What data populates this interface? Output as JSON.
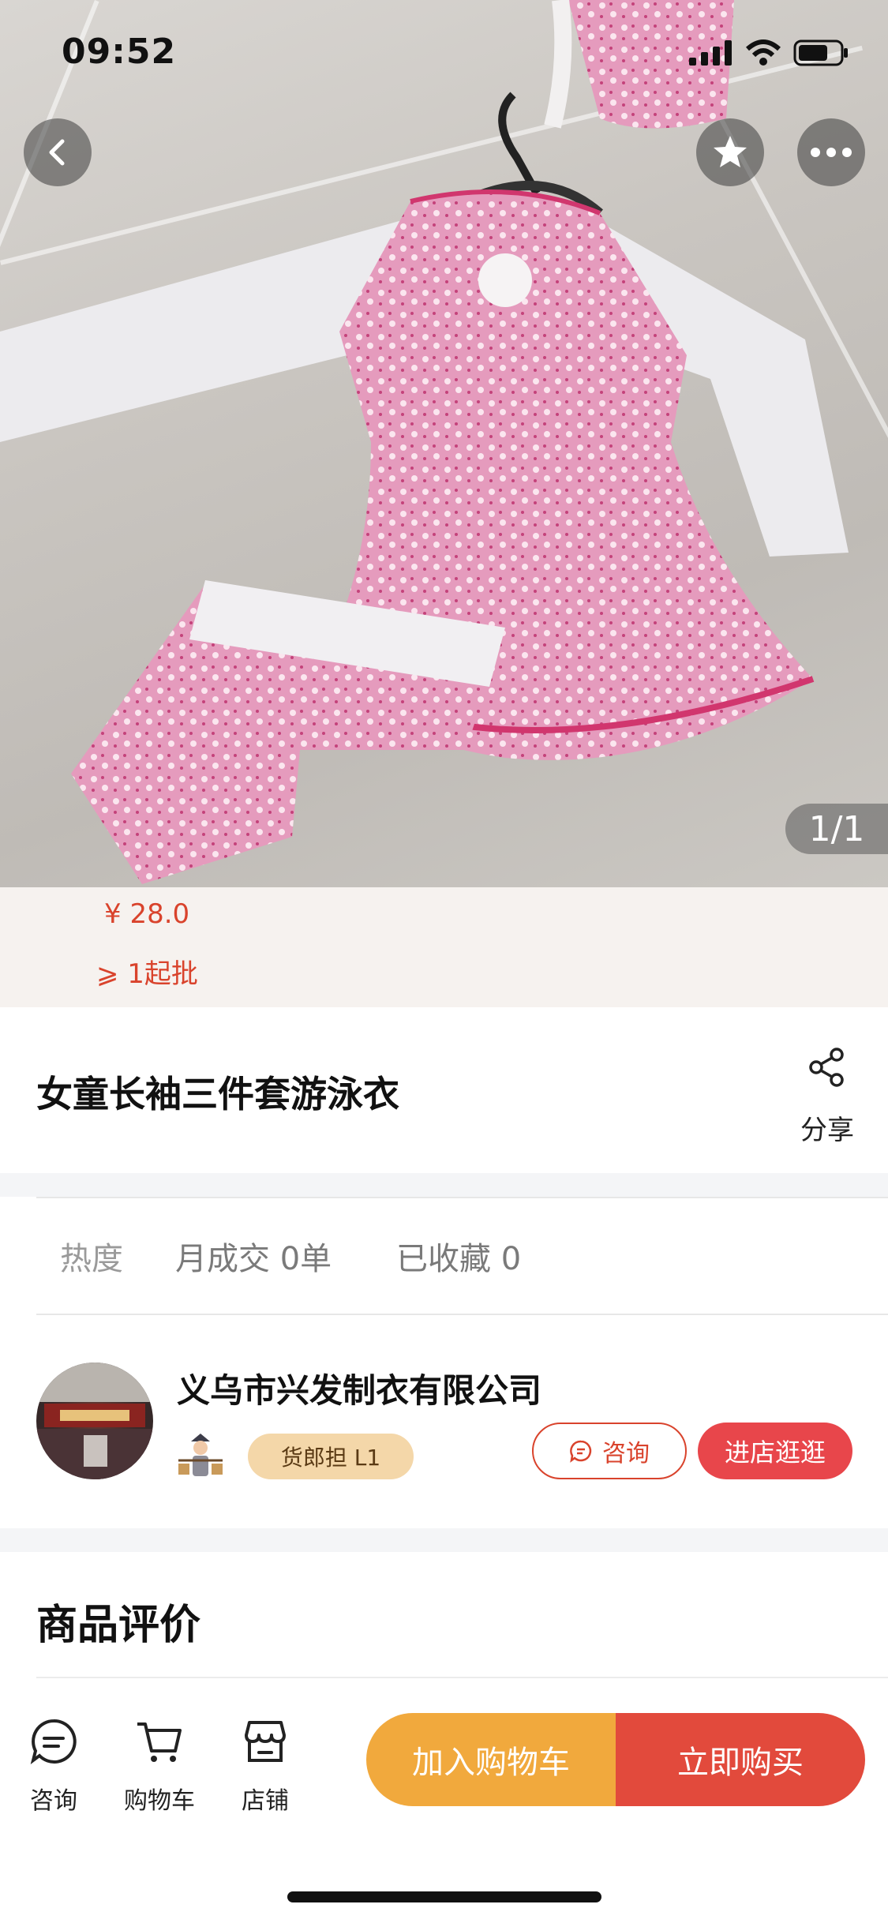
{
  "status_bar": {
    "time": "09:52"
  },
  "gallery": {
    "counter": "1/1"
  },
  "price": {
    "amount": "¥ 28.0",
    "min_order": "⩾ 1起批"
  },
  "product": {
    "title": "女童长袖三件套游泳衣",
    "share_label": "分享"
  },
  "stats": {
    "heat_label": "热度",
    "monthly_sales": "月成交 0单",
    "favorites": "已收藏 0"
  },
  "shop": {
    "name": "义乌市兴发制衣有限公司",
    "level_badge": "货郎担 L1",
    "consult_label": "咨询",
    "enter_label": "进店逛逛"
  },
  "reviews": {
    "title": "商品评价"
  },
  "bottom_bar": {
    "tabs": [
      {
        "label": "咨询",
        "icon": "chat-icon"
      },
      {
        "label": "购物车",
        "icon": "cart-icon"
      },
      {
        "label": "店铺",
        "icon": "store-icon"
      }
    ],
    "add_to_cart": "加入购物车",
    "buy_now": "立即购买"
  },
  "colors": {
    "accent_red": "#e24a3c",
    "accent_orange": "#f1a93d",
    "price_red": "#d9432c",
    "badge_gold": "#f4d7a9"
  }
}
